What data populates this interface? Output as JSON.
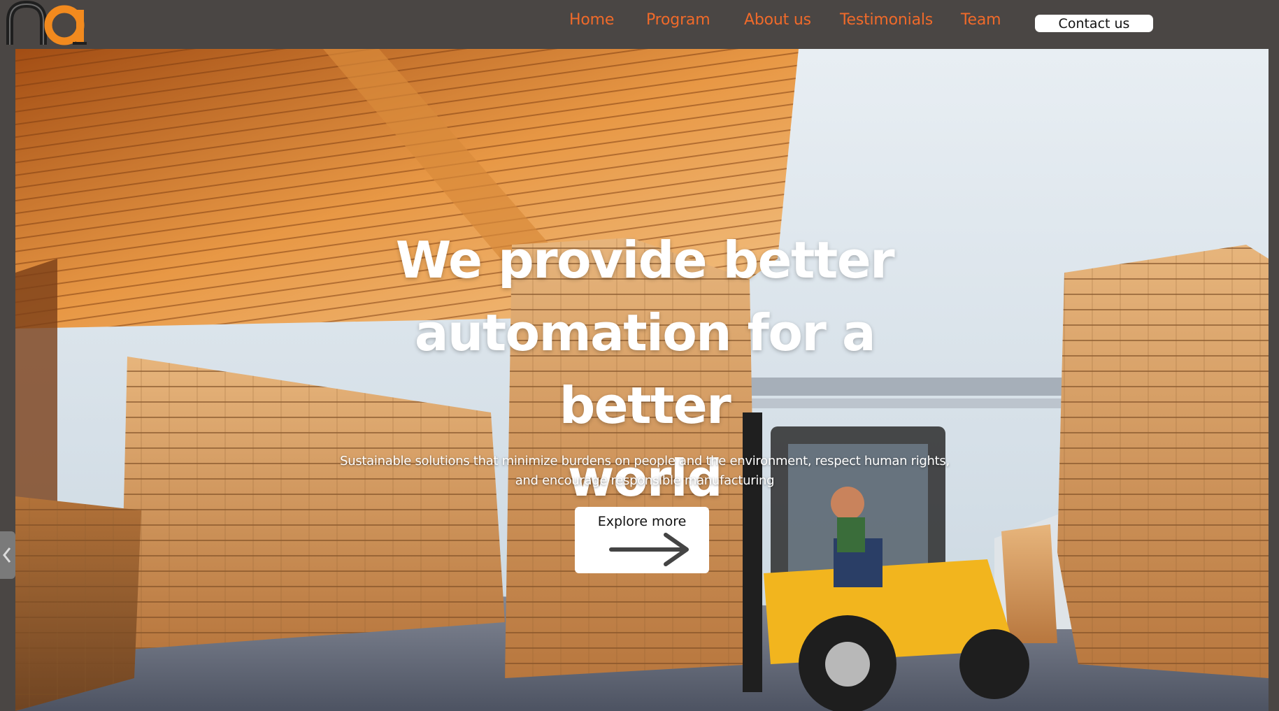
{
  "brand": {
    "logo_icon": "ra-logo",
    "accent": "#f06a2a",
    "logo_orange": "#f28a1e",
    "logo_dark": "#1f1f1f"
  },
  "nav": {
    "items": [
      {
        "label": "Home"
      },
      {
        "label": "Program"
      },
      {
        "label": "About us"
      },
      {
        "label": "Testimonials"
      },
      {
        "label": "Team"
      }
    ],
    "contact_label": "Contact us"
  },
  "hero": {
    "headline_line1": "We provide better",
    "headline_line2": "automation for a better",
    "headline_line3": "world",
    "subheadline_line1": "Sustainable solutions that minimize burdens on people and the environment, respect human rights,",
    "subheadline_line2": "and encourage responsible manufacturing",
    "cta_label": "Explore more",
    "cta_icon": "arrow-right-icon",
    "background_image": "forklift carrying stacked lumber in a warehouse yard"
  }
}
